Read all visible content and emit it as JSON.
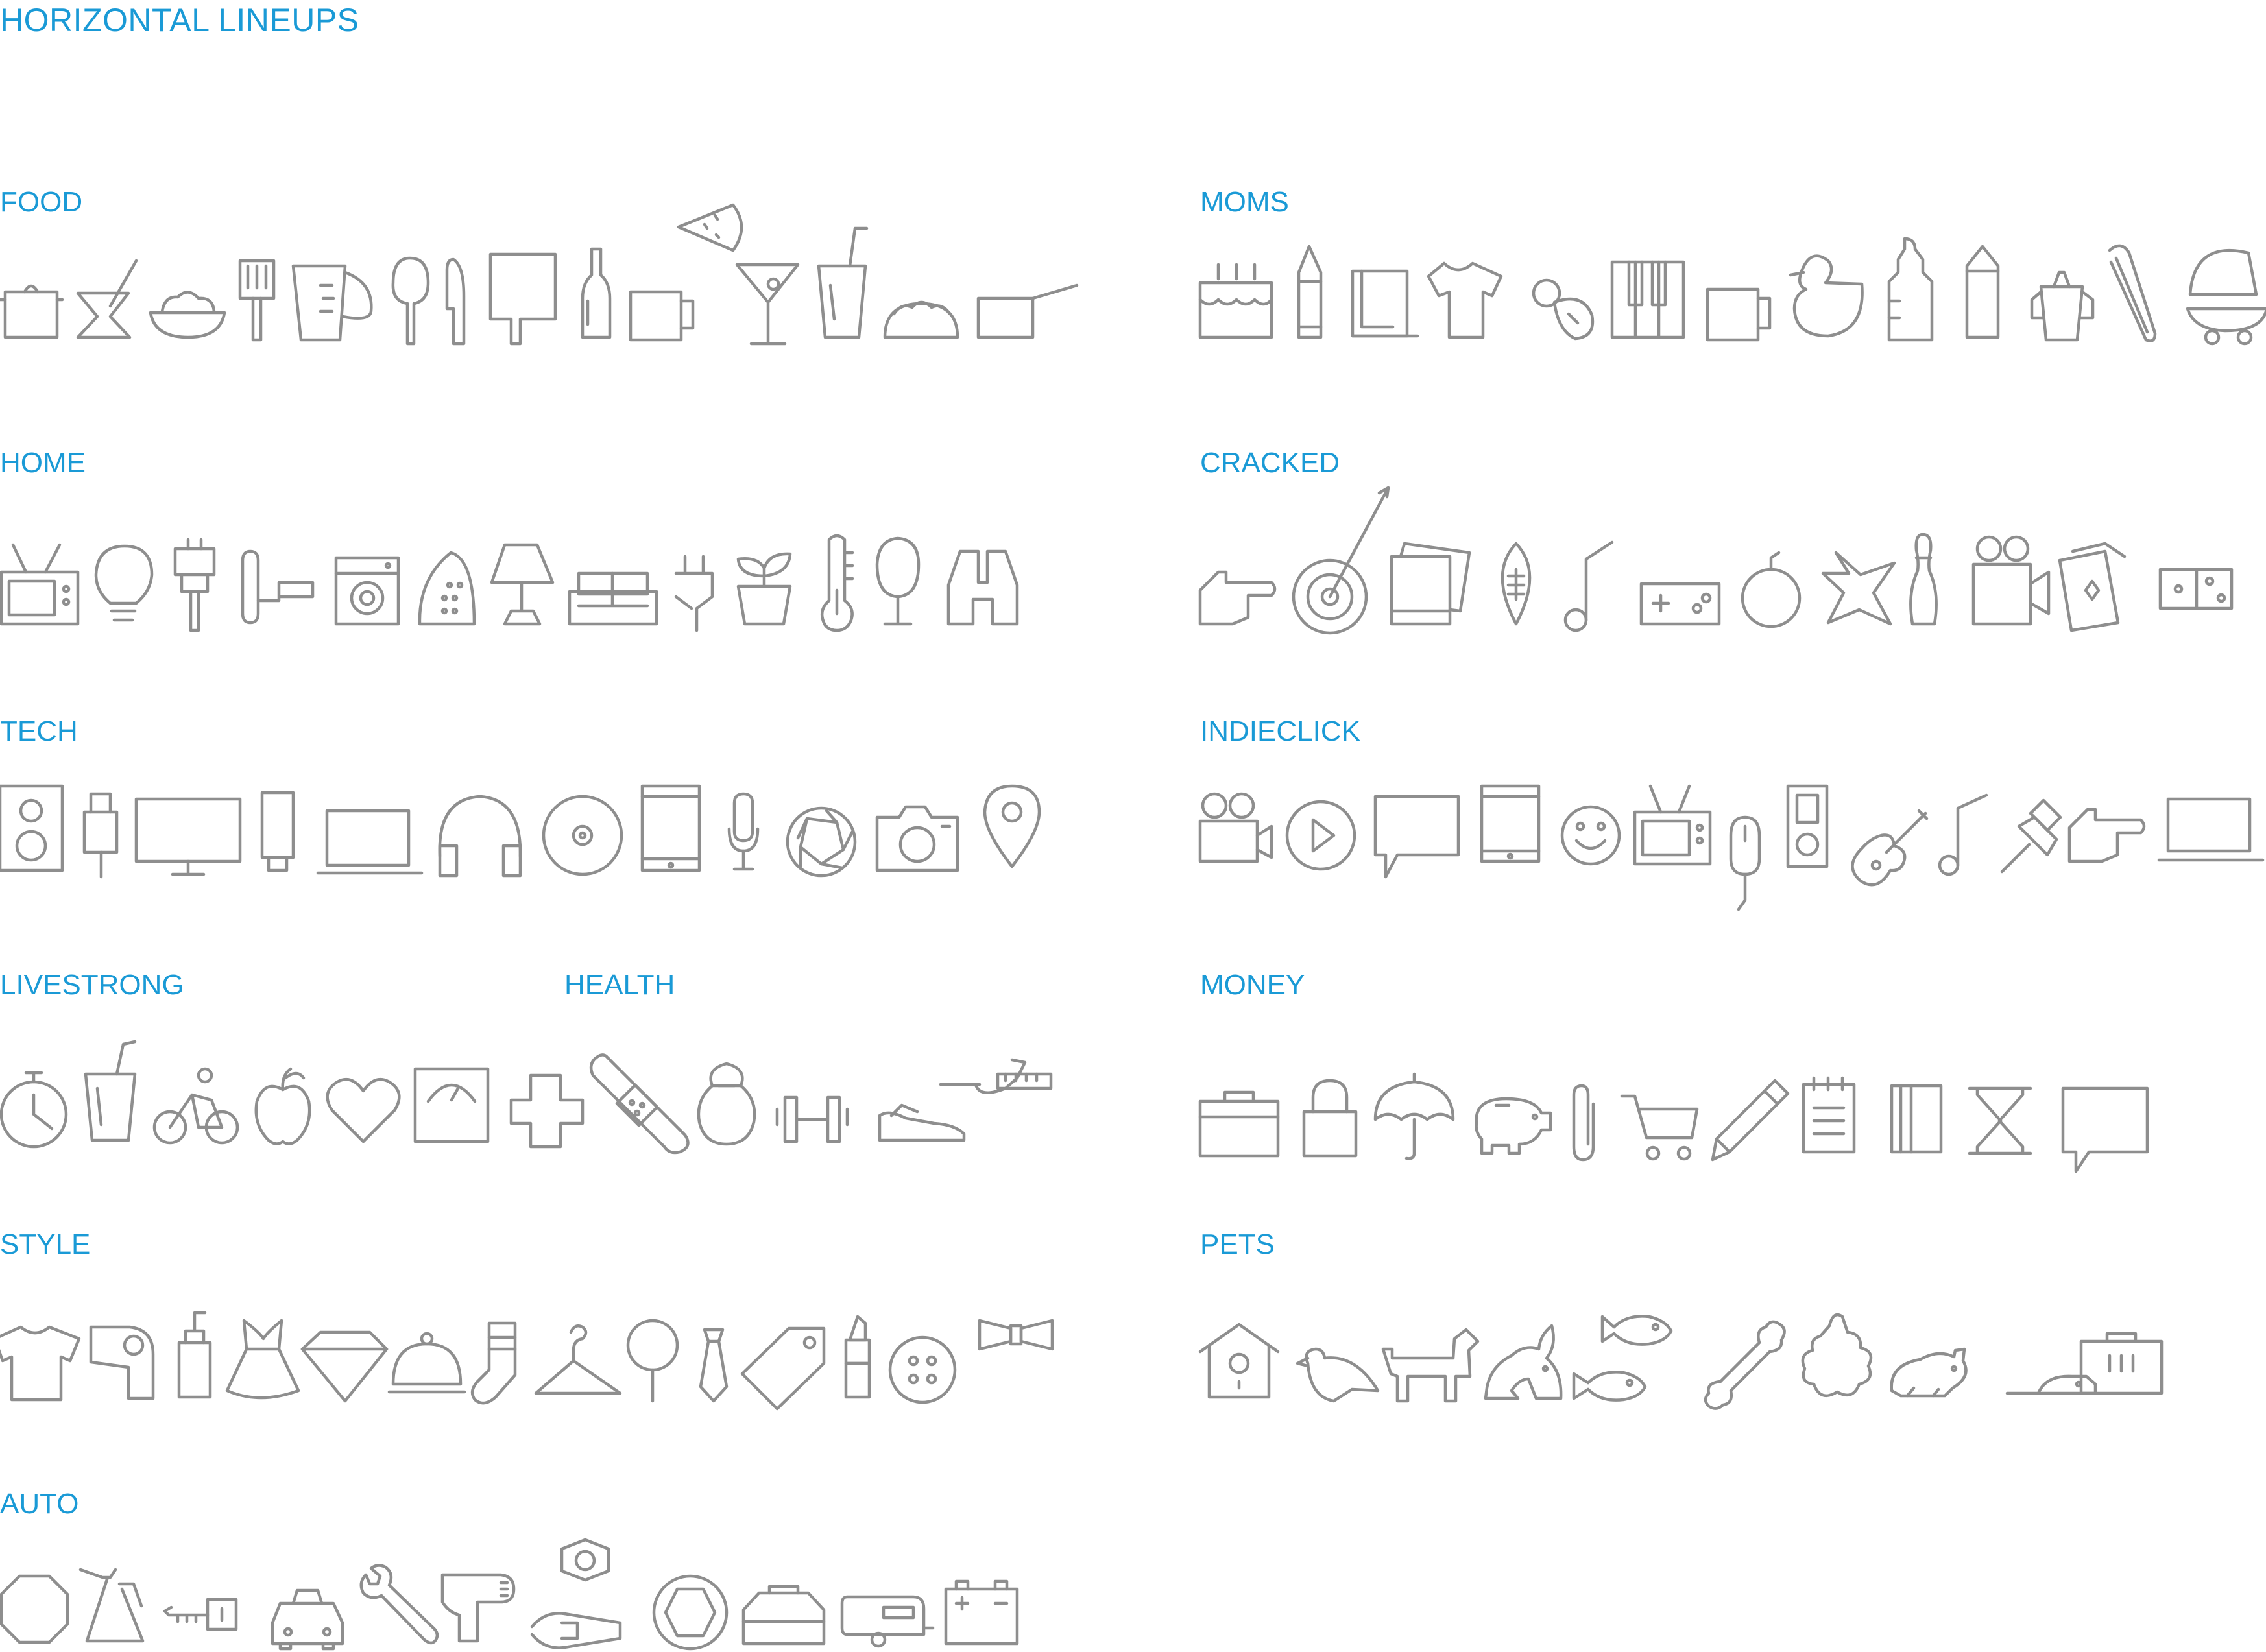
{
  "page": {
    "title": "HORIZONTAL LINEUPS"
  },
  "colors": {
    "heading": "#1a9ad6",
    "icon_stroke": "#8e8e8e",
    "background": "#ffffff"
  },
  "groups": {
    "food": {
      "label": "FOOD",
      "icons": [
        "pot-icon",
        "mortar-pestle-icon",
        "salad-bowl-icon",
        "spatula-icon",
        "measuring-cup-icon",
        "spoon-icon",
        "knife-icon",
        "cutting-board-icon",
        "bottle-icon",
        "mug-icon",
        "watermelon-slice-icon",
        "martini-glass-icon",
        "drink-cup-straw-icon",
        "taco-icon",
        "saucepan-icon"
      ]
    },
    "moms": {
      "label": "MOMS",
      "icons": [
        "birthday-cake-icon",
        "crayon-icon",
        "paper-towel-icon",
        "onesie-icon",
        "pacifier-icon",
        "piano-keys-icon",
        "mug-icon",
        "rubber-duck-icon",
        "baby-bottle-icon",
        "pencil-cup-icon",
        "sippy-cup-icon",
        "safety-pin-icon",
        "stroller-icon"
      ]
    },
    "home": {
      "label": "HOME",
      "icons": [
        "tv-icon",
        "lightbulb-icon",
        "paintbrush-icon",
        "paint-roller-icon",
        "washing-machine-icon",
        "iron-icon",
        "table-lamp-icon",
        "sofa-icon",
        "plug-icon",
        "potted-plant-icon",
        "thermometer-icon",
        "tree-icon",
        "binoculars-icon"
      ]
    },
    "cracked": {
      "label": "CRACKED",
      "icons": [
        "pointing-hand-icon",
        "target-dart-icon",
        "photos-icon",
        "football-icon",
        "music-note-icon",
        "game-controller-icon",
        "bomb-icon",
        "star-burst-icon",
        "bowling-pin-icon",
        "video-camera-icon",
        "playing-cards-icon",
        "domino-icon"
      ]
    },
    "tech": {
      "label": "TECH",
      "icons": [
        "speaker-icon",
        "usb-drive-icon",
        "monitor-icon",
        "flash-drive-icon",
        "laptop-icon",
        "headphones-icon",
        "cd-disc-icon",
        "tablet-icon",
        "microphone-icon",
        "aperture-icon",
        "camera-icon",
        "map-pin-icon"
      ]
    },
    "indieclick": {
      "label": "INDIECLICK",
      "icons": [
        "video-camera-icon",
        "play-button-icon",
        "speech-bubble-icon",
        "tablet-icon",
        "smiley-icon",
        "tv-icon",
        "mouse-icon",
        "ipod-icon",
        "guitar-icon",
        "music-note-icon",
        "push-pin-icon",
        "pointing-hand-icon",
        "laptop-icon"
      ]
    },
    "livestrong": {
      "label": "LIVESTRONG",
      "icons": [
        "stopwatch-icon",
        "drink-cup-straw-icon",
        "cyclist-icon",
        "apple-icon",
        "heart-icon"
      ]
    },
    "health": {
      "label": "HEALTH",
      "icons": [
        "scale-icon",
        "medical-cross-icon",
        "bandage-icon",
        "kettlebell-icon",
        "dumbbell-icon",
        "sneaker-icon",
        "measuring-tape-icon"
      ]
    },
    "money": {
      "label": "MONEY",
      "icons": [
        "briefcase-icon",
        "padlock-icon",
        "umbrella-icon",
        "piggy-bank-icon",
        "paper-clip-icon",
        "shopping-cart-icon",
        "pencil-icon",
        "notepad-icon",
        "book-icon",
        "hourglass-icon",
        "speech-bubble-icon"
      ]
    },
    "style": {
      "label": "STYLE",
      "icons": [
        "t-shirt-icon",
        "hair-dryer-icon",
        "lotion-bottle-icon",
        "dress-icon",
        "diamond-icon",
        "cloche-icon",
        "sock-icon",
        "hanger-icon",
        "mirror-icon",
        "necktie-icon",
        "price-tag-icon",
        "lipstick-icon",
        "button-icon",
        "bow-tie-icon"
      ]
    },
    "pets": {
      "label": "PETS",
      "icons": [
        "birdhouse-icon",
        "bird-icon",
        "dog-icon",
        "rabbit-icon",
        "fish-pair-icon",
        "bone-icon",
        "turtle-icon",
        "hamster-icon",
        "mouse-pet-icon",
        "pet-carrier-icon"
      ]
    },
    "auto": {
      "label": "AUTO",
      "icons": [
        "stop-sign-icon",
        "oil-can-icon",
        "car-key-icon",
        "car-icon",
        "wrench-icon",
        "air-pump-icon",
        "spark-plug-icon",
        "tire-icon",
        "car-hood-icon",
        "camper-trailer-icon",
        "battery-icon"
      ]
    }
  }
}
